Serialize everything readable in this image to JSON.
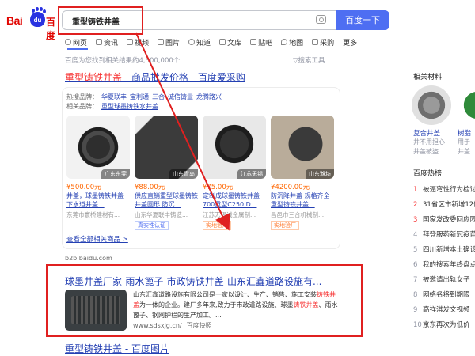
{
  "header": {
    "logo_bai": "Bai",
    "logo_paw": "du",
    "logo_du": "百度",
    "query": "重型铸铁井盖",
    "search_button": "百度一下"
  },
  "tabs": [
    {
      "label": "网页"
    },
    {
      "label": "资讯"
    },
    {
      "label": "视频"
    },
    {
      "label": "图片"
    },
    {
      "label": "知道"
    },
    {
      "label": "文库"
    },
    {
      "label": "贴吧"
    },
    {
      "label": "地图"
    },
    {
      "label": "采购"
    },
    {
      "label": "更多"
    }
  ],
  "result_count": "百度为您找到相关结果约4,300,000个",
  "search_tools": "搜索工具",
  "result1": {
    "title_a": "重型铸铁井盖",
    "title_b": " - 商品批发价格 - 百度爱采购",
    "hot_label": "热搜品牌：",
    "hot_brands": [
      "华夏联丰",
      "宝利通",
      "三合",
      "诚信铸业",
      "龙腾路兴"
    ],
    "related_label": "相关品牌：",
    "related_brand": "重型球墨铸铁水井盖",
    "products": [
      {
        "location": "广东东莞",
        "price": "¥500.00元",
        "title": "井盖，球墨铸铁井盖 下水道井盖...",
        "seller": "东莞市寰桥建材有...",
        "badge": ""
      },
      {
        "location": "山东青岛",
        "price": "¥88.00元",
        "title": "供应直销重型球墨铸铁井盖圆形 防沉...",
        "seller": "山东华夏联丰铸造...",
        "badge": "真实性认证"
      },
      {
        "location": "江苏无锡",
        "price": "¥75.00元",
        "title": "定制成球墨铸铁井盖700重型C250 D...",
        "seller": "江苏无锡诚金属制...",
        "badge": "实地验厂"
      },
      {
        "location": "山东潍坊",
        "price": "¥4200.00元",
        "title": "防沉降井盖 规格齐全 重型铸铁井盖...",
        "seller": "昌邑市三合机械制...",
        "badge": "实地验厂"
      }
    ],
    "see_more": "查看全部相关商品 >",
    "url": "b2b.baidu.com"
  },
  "result2": {
    "title": "球墨井盖厂家-雨水篦子-市政铸铁井盖-山东汇鑫道路设施有...",
    "snippet_a": "山东汇鑫道路设施有限公司是一家以设计、生产、销售、施工安装",
    "snippet_b": "铸铁井盖",
    "snippet_c": "为一体的企业。建厂多年来,致力于市政道路设施、球墨",
    "snippet_d": "铸铁井盖",
    "snippet_e": "、雨水篦子、钢网护栏的生产加工。...",
    "url": "www.sdsxjg.cn/",
    "snapshot": "百度快照"
  },
  "result3": {
    "title": "重型铸铁井盖 - 百度图片"
  },
  "right_panel": {
    "related_title": "相关材料",
    "items": [
      {
        "name": "复合井盖",
        "sub1": "井不用担心",
        "sub2": "井盖被盗"
      },
      {
        "name": "树脂",
        "sub1": "用于",
        "sub2": "井盖"
      }
    ],
    "hot_title": "百度热榜",
    "hot_list": [
      {
        "n": "1",
        "text": "被逼弯性行为检讨"
      },
      {
        "n": "2",
        "text": "31省区市新增12例"
      },
      {
        "n": "3",
        "text": "国家发改委回应限电"
      },
      {
        "n": "4",
        "text": "拜登服药新冠疫苗"
      },
      {
        "n": "5",
        "text": "四川新增本土确诊"
      },
      {
        "n": "6",
        "text": "我的搜索年终盘点"
      },
      {
        "n": "7",
        "text": "被邀请出轨女子"
      },
      {
        "n": "8",
        "text": "网络名将到期限"
      },
      {
        "n": "9",
        "text": "高祥淇发文视频"
      },
      {
        "n": "10",
        "text": "京东再次为低价"
      }
    ]
  },
  "colors": {
    "accent": "#4e6ef2",
    "link": "#2440b3",
    "highlight": "#f73131",
    "annotation": "#e02020",
    "price": "#ff6600"
  }
}
